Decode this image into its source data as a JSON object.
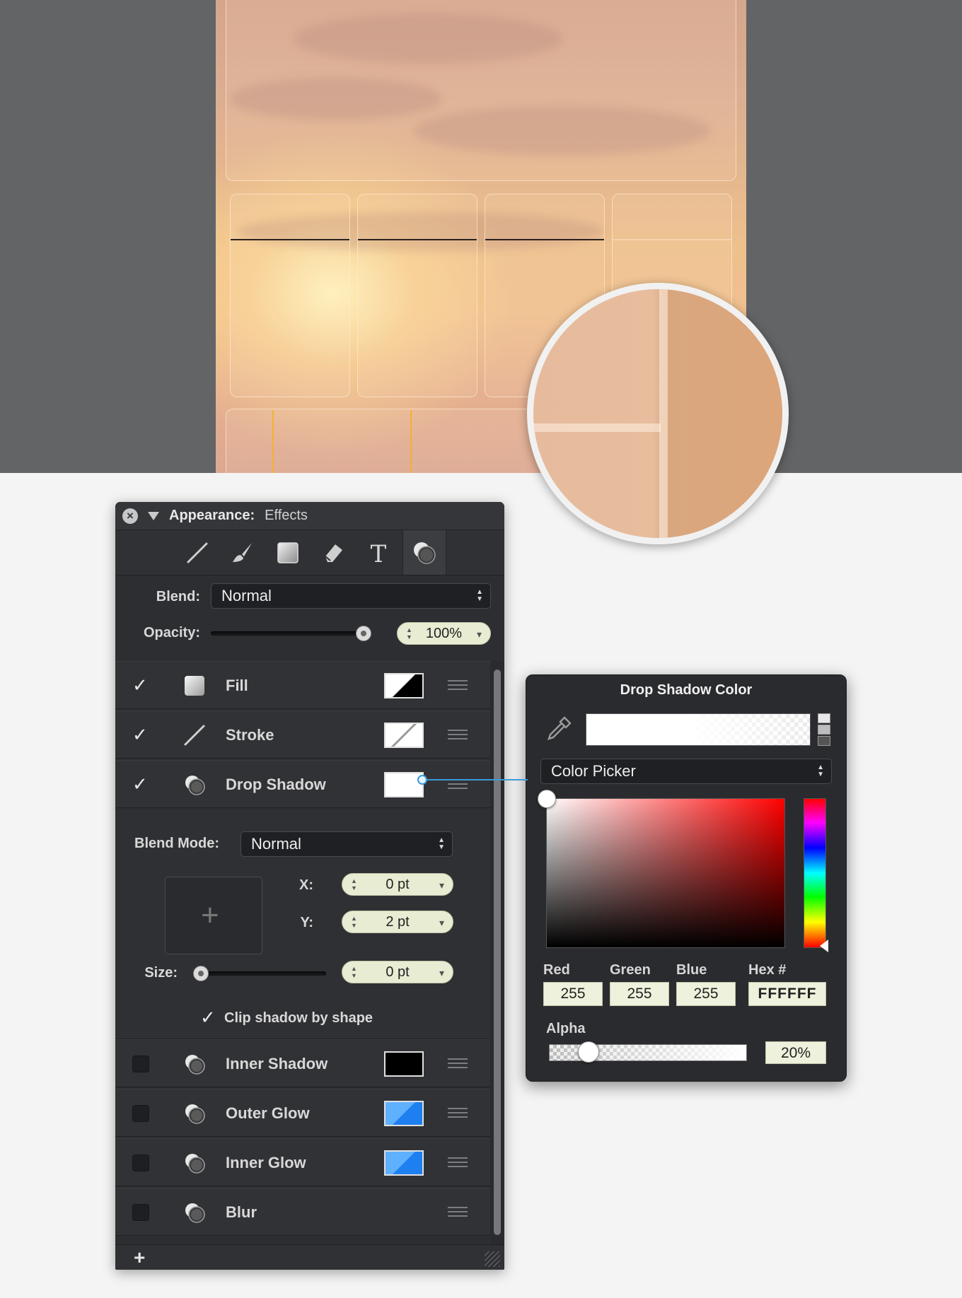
{
  "panel": {
    "title_label": "Appearance:",
    "title_sub": "Effects",
    "blend_label": "Blend:",
    "blend_value": "Normal",
    "opacity_label": "Opacity:",
    "opacity_value": "100%",
    "opacity_fraction": 1.0,
    "tools": [
      "line-tool-icon",
      "brush-tool-icon",
      "fill-tool-icon",
      "eraser-tool-icon",
      "text-tool-icon",
      "effects-tool-icon"
    ],
    "effects": [
      {
        "label": "Fill",
        "checked": true,
        "icon": "fill-icon",
        "swatch": "#000000"
      },
      {
        "label": "Stroke",
        "checked": true,
        "icon": "stroke-icon",
        "swatch": "#ffffff"
      },
      {
        "label": "Drop Shadow",
        "checked": true,
        "icon": "shadow-icon",
        "swatch": "#ffffff"
      }
    ],
    "effects_after": [
      {
        "label": "Inner Shadow",
        "checked": false,
        "icon": "shadow-icon",
        "swatch": "#000000"
      },
      {
        "label": "Outer Glow",
        "checked": false,
        "icon": "shadow-icon",
        "swatch": "#1e88ff"
      },
      {
        "label": "Inner Glow",
        "checked": false,
        "icon": "shadow-icon",
        "swatch": "#1e88ff"
      },
      {
        "label": "Blur",
        "checked": false,
        "icon": "shadow-icon",
        "swatch": ""
      }
    ],
    "shadow": {
      "blend_mode_label": "Blend Mode:",
      "blend_mode_value": "Normal",
      "x_label": "X:",
      "x_value": "0 pt",
      "y_label": "Y:",
      "y_value": "2 pt",
      "size_label": "Size:",
      "size_value": "0 pt",
      "size_fraction": 0.0,
      "clip_label": "Clip shadow by shape",
      "clip_checked": true
    },
    "add_label": "+"
  },
  "color_picker": {
    "title": "Drop Shadow Color",
    "mode_value": "Color Picker",
    "red_label": "Red",
    "green_label": "Green",
    "blue_label": "Blue",
    "hex_label": "Hex #",
    "red": "255",
    "green": "255",
    "blue": "255",
    "hex": "FFFFFF",
    "alpha_label": "Alpha",
    "alpha_value": "20%",
    "alpha_fraction": 0.2
  },
  "colors": {
    "panel_bg": "#2d2e31",
    "canvas_bg": "#636466",
    "accent": "#3a9bd9",
    "field_bg": "#eef1dc"
  }
}
